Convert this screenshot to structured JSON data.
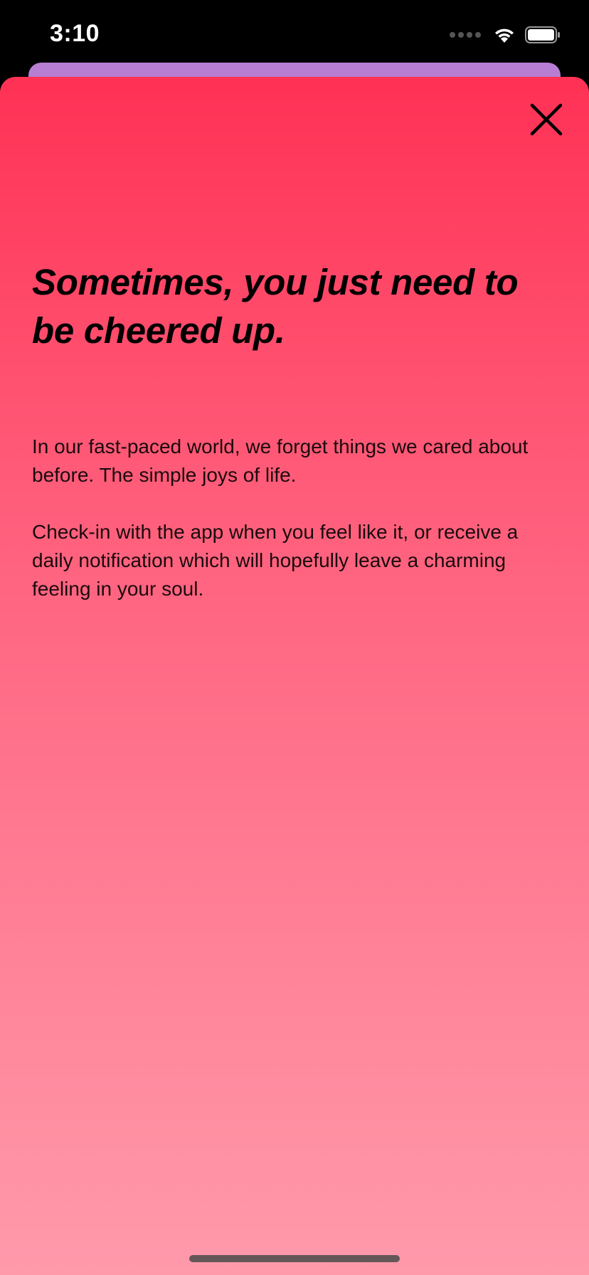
{
  "status_bar": {
    "time": "3:10",
    "icons": [
      "cellular-signal-icon",
      "wifi-icon",
      "battery-icon"
    ]
  },
  "colors": {
    "sheet_gradient_top": "#ff3155",
    "sheet_gradient_bottom": "#ff9aab",
    "card_behind": "#b87ed4",
    "text": "#000000"
  },
  "sheet": {
    "close_icon": "close-icon",
    "headline": "Sometimes, you just need to be cheered up.",
    "paragraphs": [
      "In our fast-paced world, we forget things we cared about before. The simple joys of life.",
      "Check-in with the app when you feel like it, or receive a daily notification which will hopefully leave a charming feeling in your soul."
    ]
  }
}
